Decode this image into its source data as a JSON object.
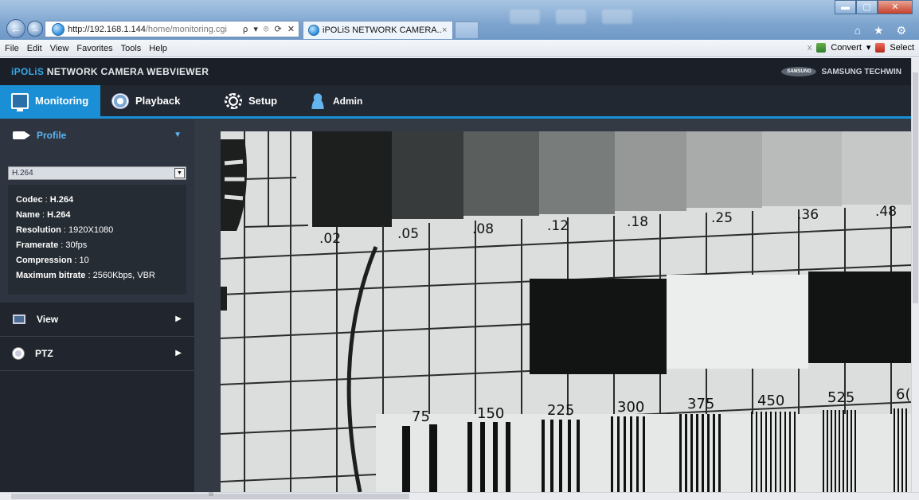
{
  "browser": {
    "url_host": "http://192.168.1.144",
    "url_path": "/home/monitoring.cgi",
    "address_tools": "ρ ▾ ⌾ ⟳ ✕",
    "tab_title": "iPOLiS NETWORK CAMERA...",
    "tab_close": "×",
    "window_buttons": {
      "minimize": "▬",
      "maximize": "▢",
      "close": "✕"
    },
    "toolbar_icons": "⌂ ★ ⚙",
    "menu": [
      "File",
      "Edit",
      "View",
      "Favorites",
      "Tools",
      "Help"
    ],
    "menu_right": {
      "close": "x",
      "convert": "Convert",
      "select": "Select",
      "convert_caret": "▾"
    }
  },
  "app": {
    "brand_prefix": "iPOLiS",
    "brand_suffix": "NETWORK CAMERA WEBVIEWER",
    "vendor_logo": "SAMSUNG",
    "vendor_name": "SAMSUNG TECHWIN",
    "nav": {
      "monitoring": "Monitoring",
      "playback": "Playback",
      "setup": "Setup",
      "admin": "Admin"
    }
  },
  "sidebar": {
    "profile_label": "Profile",
    "profile_select": "H.264",
    "profile_info": {
      "codec_label": "Codec",
      "codec": "H.264",
      "name_label": "Name",
      "name": "H.264",
      "resolution_label": "Resolution",
      "resolution": "1920X1080",
      "framerate_label": "Framerate",
      "framerate": "30fps",
      "compression_label": "Compression",
      "compression": "10",
      "bitrate_label": "Maximum bitrate",
      "bitrate": "2560Kbps, VBR"
    },
    "view_label": "View",
    "ptz_label": "PTZ",
    "expanded_arrow": "▼",
    "collapsed_arrow": "▶"
  },
  "video_chart": {
    "density_labels": [
      ".02",
      ".05",
      ".08",
      ".12",
      ".18",
      ".25",
      ".36",
      ".48"
    ],
    "resolution_labels": [
      "75",
      "150",
      "225",
      "300",
      "375",
      "450",
      "525",
      "6("
    ]
  }
}
